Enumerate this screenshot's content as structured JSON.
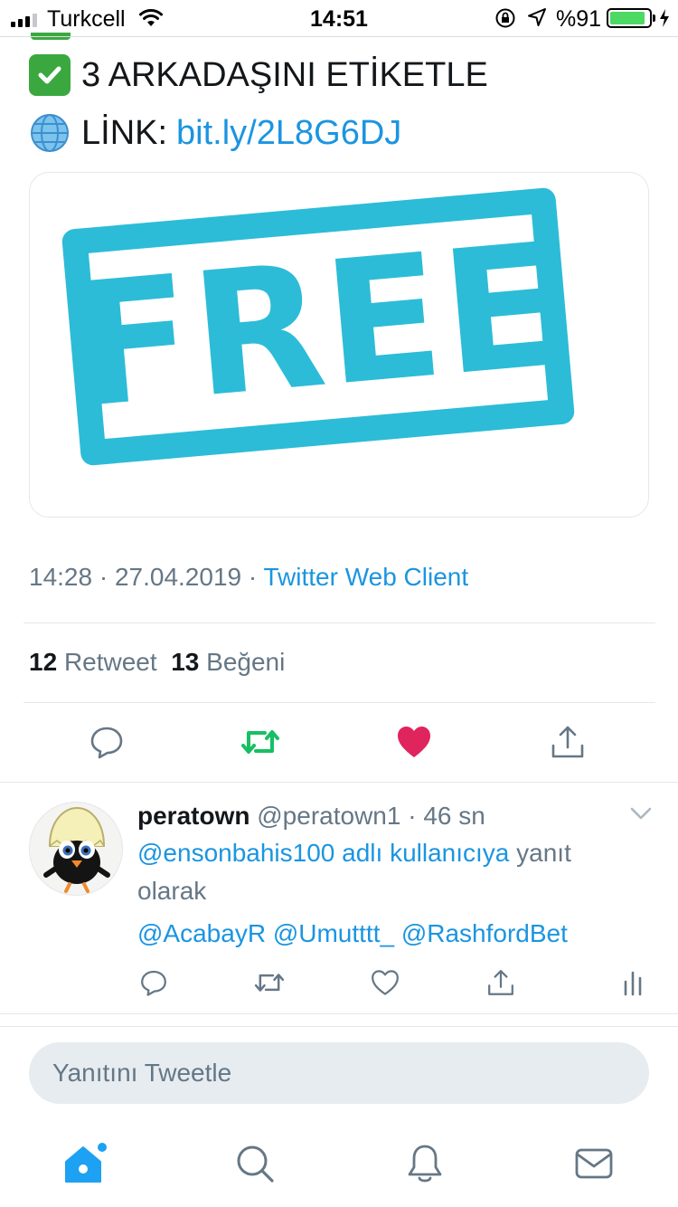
{
  "status_bar": {
    "carrier": "Turkcell",
    "time": "14:51",
    "battery_percent": "%91",
    "battery_level": 0.91
  },
  "tweet": {
    "line1": "3 ARKADAŞINI ETİKETLE",
    "line2_label": "LİNK:",
    "link": "bit.ly/2L8G6DJ",
    "image_text": "FREE",
    "timestamp": "14:28 · 27.04.2019 · ",
    "client": "Twitter Web Client",
    "retweet_count": "12",
    "retweet_label": "Retweet",
    "like_count": "13",
    "like_label": "Beğeni",
    "colors": {
      "retweet_active": "#17bf63",
      "like_active": "#e0245e",
      "link": "#1b95e0"
    }
  },
  "reply": {
    "name": "peratown",
    "handle": "@peratown1",
    "separator": " · ",
    "time": "46 sn",
    "context_mention": "@ensonbahis100 adlı kullanıcıya",
    "context_suffix": " yanıt olarak",
    "mentions": "@AcabayR @Umutttt_ @RashfordBet"
  },
  "compose": {
    "placeholder": "Yanıtını Tweetle"
  },
  "tab_bar": {
    "items": [
      "home-icon",
      "search-icon",
      "notifications-icon",
      "messages-icon"
    ],
    "active_color": "#1da1f2"
  }
}
